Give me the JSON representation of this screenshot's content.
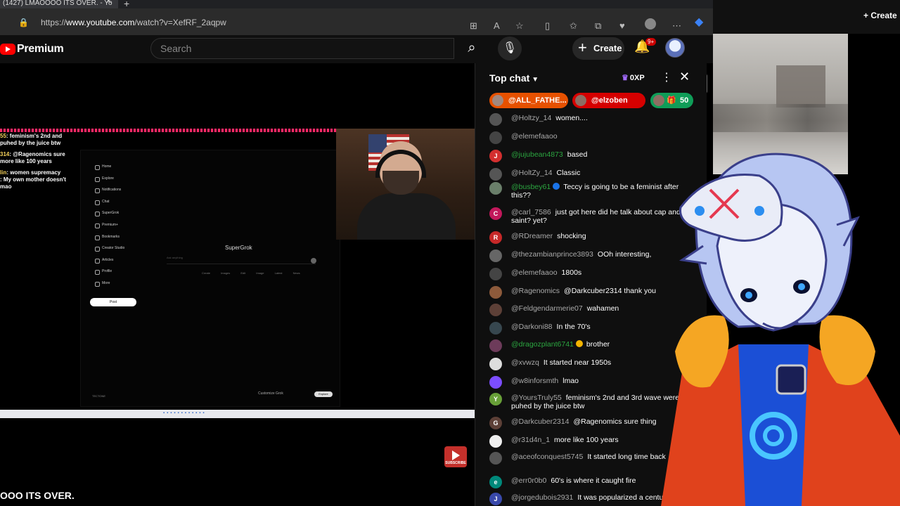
{
  "browser": {
    "tab_title": "(1427) LMAOOOO ITS OVER. - Yo",
    "url_prefix": "https://",
    "url_host": "www.youtube.com",
    "url_path": "/watch?v=XefRF_2aqpw"
  },
  "header": {
    "logo_text": "Premium",
    "search_placeholder": "Search",
    "create_label": "Create",
    "notifications_badge": "9+",
    "right_create_label": "Create"
  },
  "video": {
    "title_partial": "OOO ITS OVER.",
    "subscribe_label": "SUBSCRIBE",
    "stream_chat": [
      {
        "user": "55",
        "text": ": feminism's 2nd and"
      },
      {
        "user": "",
        "text": "puhed by the juice btw"
      },
      {
        "user": "314",
        "text": ": @Ragenomics sure"
      },
      {
        "user": "",
        "text": "more like 100 years"
      },
      {
        "user": "lin",
        "text": ": women supremacy"
      },
      {
        "user": "",
        "text": ": My own mother doesn't"
      },
      {
        "user": "",
        "text": "mao"
      }
    ],
    "grok": {
      "nav": [
        "Home",
        "Explore",
        "Notifications",
        "Chat",
        "SuperGrok",
        "Premium+",
        "Bookmarks",
        "Creator Studio",
        "Articles",
        "Profile",
        "More"
      ],
      "post_label": "Post",
      "logo_text": "SuperGrok",
      "input_placeholder": "Ask anything",
      "tags": "Create Images Edit Image Latest News",
      "customize": "Customize Grok",
      "explore": "Explore",
      "user": "TECTONE"
    }
  },
  "chat": {
    "title": "Top chat",
    "xp": "0XP",
    "pinned": [
      {
        "label": "@ALL_FATHE...",
        "color": "#e65100"
      },
      {
        "label": "@elzoben",
        "color": "#d50000"
      },
      {
        "label": "50",
        "color": "#0f9d58"
      }
    ],
    "messages": [
      {
        "author": "@Holtzy_14",
        "text": "women....",
        "green": false,
        "avatar": "#555",
        "letter": ""
      },
      {
        "author": "@elemefaaoo",
        "text": "",
        "green": false,
        "avatar": "#444",
        "letter": ""
      },
      {
        "author": "@jujubean4873",
        "text": "based",
        "green": true,
        "avatar": "#d32f2f",
        "letter": "J"
      },
      {
        "author": "@HoltZy_14",
        "text": "Classic",
        "green": false,
        "avatar": "#555",
        "letter": ""
      },
      {
        "author": "@busbey61",
        "text": "Teccy is going to be a feminist after this??",
        "green": true,
        "avatar": "#6a7f6a",
        "letter": "",
        "badge": "#1a73e8"
      },
      {
        "author": "@carl_7586",
        "text": "just got here did he talk about cap and saint? yet?",
        "green": false,
        "avatar": "#c2185b",
        "letter": "C"
      },
      {
        "author": "@RDreamer",
        "text": "shocking",
        "green": false,
        "avatar": "#c62828",
        "letter": "R"
      },
      {
        "author": "@thezambianprince3893",
        "text": "OOh interesting,",
        "green": false,
        "avatar": "#666",
        "letter": ""
      },
      {
        "author": "@elemefaaoo",
        "text": "1800s",
        "green": false,
        "avatar": "#444",
        "letter": ""
      },
      {
        "author": "@Ragenomics",
        "text": "@Darkcuber2314 thank you",
        "green": false,
        "avatar": "#8d5a3b",
        "letter": ""
      },
      {
        "author": "@Feldgendarmerie07",
        "text": "wahamen",
        "green": false,
        "avatar": "#5d4037",
        "letter": ""
      },
      {
        "author": "@Darkoni88",
        "text": "In the 70's",
        "green": false,
        "avatar": "#37474f",
        "letter": ""
      },
      {
        "author": "@dragozplant6741",
        "text": "brother",
        "green": true,
        "avatar": "#6d3b5a",
        "letter": "",
        "badge": "#f4b400"
      },
      {
        "author": "@xvwzq",
        "text": "It started near 1950s",
        "green": false,
        "avatar": "#ddd",
        "letter": ""
      },
      {
        "author": "@w8inforsmth",
        "text": "lmao",
        "green": false,
        "avatar": "#7c4dff",
        "letter": ""
      },
      {
        "author": "@YoursTruly55",
        "text": "feminism's 2nd and 3rd wave were puhed by the juice btw",
        "green": false,
        "avatar": "#689f38",
        "letter": "Y"
      },
      {
        "author": "@Darkcuber2314",
        "text": "@Ragenomics sure thing",
        "green": false,
        "avatar": "#5d4037",
        "letter": "G"
      },
      {
        "author": "@r31d4n_1",
        "text": "more like 100 years",
        "green": false,
        "avatar": "#eee",
        "letter": ""
      },
      {
        "author": "@aceofconquest5745",
        "text": "It started long time back",
        "green": false,
        "avatar": "#555",
        "letter": ""
      },
      {
        "author": "@err0r0b0",
        "text": "60's is where it caught fire",
        "green": false,
        "avatar": "#00897b",
        "letter": "e"
      },
      {
        "author": "@jorgedubois2931",
        "text": "It was popularized a century",
        "green": false,
        "avatar": "#3949ab",
        "letter": "J"
      }
    ]
  }
}
